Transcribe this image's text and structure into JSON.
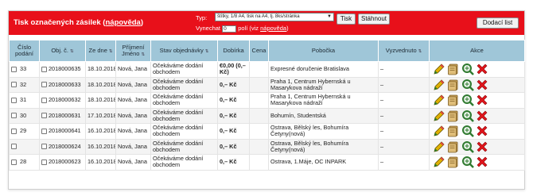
{
  "header": {
    "title": "Tisk označených zásilek",
    "help_link": "nápověda",
    "typ_label": "Typ:",
    "typ_value": "štítky, 1/8 A4, tisk na A4, tj. 8ks/stránka",
    "print_button": "Tisk",
    "download_button": "Stáhnout",
    "skip_label": "Vynechat",
    "skip_value": "0",
    "skip_suffix": "polí (viz",
    "skip_help_link": "nápověda",
    "skip_close": ")",
    "delivery_list_button": "Dodací list"
  },
  "table": {
    "columns": {
      "cislo": "Číslo podání",
      "obj": "Obj. č.",
      "ze_dne": "Ze dne",
      "prijmeni": "Příjmení Jméno",
      "stav": "Stav objednávky",
      "dobirka": "Dobírka",
      "cena": "Cena",
      "pobocka": "Pobočka",
      "vyzvednuto": "Vyzvednuto",
      "akce": "Akce"
    },
    "sort_glyph": "⇅",
    "rows": [
      {
        "cislo": "33",
        "obj": "2018000635",
        "date": "18.10.2018",
        "name": "Nová, Jana",
        "stav": "Očekáváme dodání obchodem",
        "dobirka": "€0,00 (0,– Kč)",
        "cena": "",
        "pobocka": "Expresné doručenie Bratislava",
        "vyzv": "–"
      },
      {
        "cislo": "32",
        "obj": "2018000633",
        "date": "18.10.2018",
        "name": "Nová, Jana",
        "stav": "Očekáváme dodání obchodem",
        "dobirka": "0,– Kč",
        "cena": "",
        "pobocka": "Praha 1, Centrum Hybernská u Masarykova nádraží",
        "vyzv": "–"
      },
      {
        "cislo": "31",
        "obj": "2018000632",
        "date": "18.10.2018",
        "name": "Nová, Jana",
        "stav": "Očekáváme dodání obchodem",
        "dobirka": "0,– Kč",
        "cena": "",
        "pobocka": "Praha 1, Centrum Hybernská u Masarykova nádraží",
        "vyzv": "–"
      },
      {
        "cislo": "30",
        "obj": "2018000631",
        "date": "17.10.2018",
        "name": "Nová, Jana",
        "stav": "Očekáváme dodání obchodem",
        "dobirka": "0,– Kč",
        "cena": "",
        "pobocka": "Bohumín, Studentská",
        "vyzv": "–"
      },
      {
        "cislo": "29",
        "obj": "2018000641",
        "date": "16.10.2018",
        "name": "Nová, Jana",
        "stav": "Očekáváme dodání obchodem",
        "dobirka": "0,– Kč",
        "cena": "",
        "pobocka": "Ostrava, Bělský les, Bohumíra Četyny(nová)",
        "vyzv": "–"
      },
      {
        "cislo": "",
        "obj": "2018000624",
        "date": "16.10.2018",
        "name": "Nová, Jana",
        "stav": "Očekáváme dodání obchodem",
        "dobirka": "0,– Kč",
        "cena": "",
        "pobocka": "Ostrava, Bělský les, Bohumíra Četyny(nová)",
        "vyzv": "–"
      },
      {
        "cislo": "28",
        "obj": "2018000623",
        "date": "16.10.2018",
        "name": "Nová, Jana",
        "stav": "Očekáváme dodání obchodem",
        "dobirka": "0,– Kč",
        "cena": "",
        "pobocka": "Ostrava, 1.Máje, OC INPARK",
        "vyzv": "–"
      }
    ]
  },
  "icons": {
    "edit": "pencil-icon",
    "labels": "labels-icon",
    "detail": "magnifier-icon",
    "delete": "delete-icon"
  },
  "colors": {
    "accent_red": "#e8101a",
    "header_blue": "#9fc6d8"
  }
}
